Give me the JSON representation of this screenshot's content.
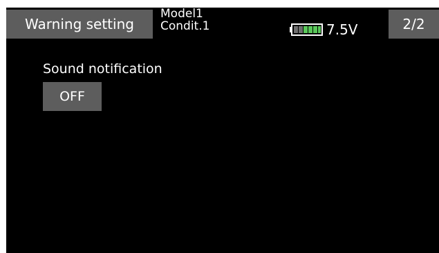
{
  "header": {
    "title": "Warning setting",
    "model_name": "Model1",
    "condition": "Condit.1",
    "battery_icon": "battery-icon",
    "battery_color": "#5ac85a",
    "voltage": "7.5V",
    "page_indicator": "2/2"
  },
  "main": {
    "sound_notification_label": "Sound notification",
    "sound_notification_value": "OFF"
  },
  "colors": {
    "background": "#000000",
    "tab": "#5d5d5d",
    "text": "#ffffff"
  }
}
